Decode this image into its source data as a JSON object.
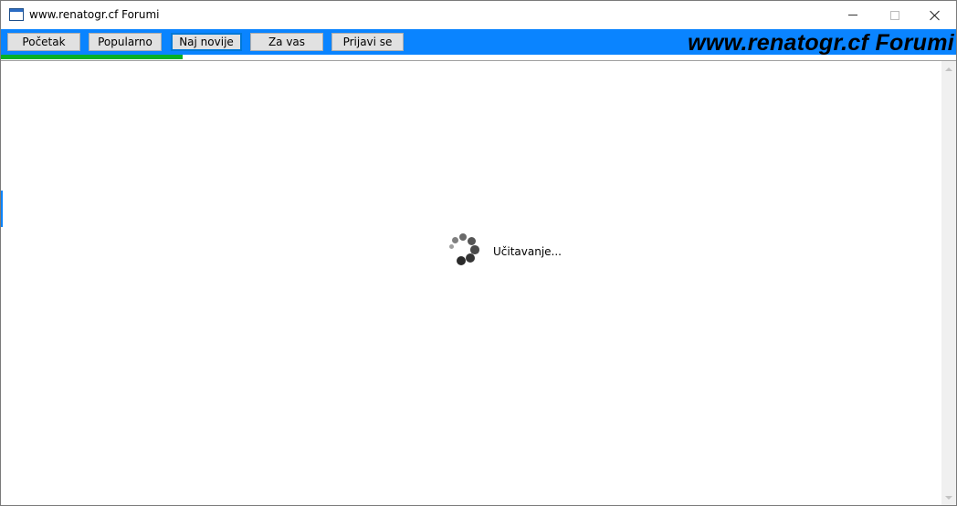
{
  "window": {
    "title": "www.renatogr.cf Forumi",
    "icon": "window-icon"
  },
  "toolbar": {
    "background": "#0a84ff",
    "buttons": [
      {
        "label": "Početak"
      },
      {
        "label": "Popularno"
      },
      {
        "label": "Naj novije"
      },
      {
        "label": "Za vas"
      },
      {
        "label": "Prijavi se"
      }
    ],
    "brand": "www.renatogr.cf Forumi"
  },
  "progress": {
    "value": 0.19,
    "color": "#06b025"
  },
  "content": {
    "loading_text": "Učitavanje...",
    "spinner_icon": "loading-spinner-icon"
  }
}
